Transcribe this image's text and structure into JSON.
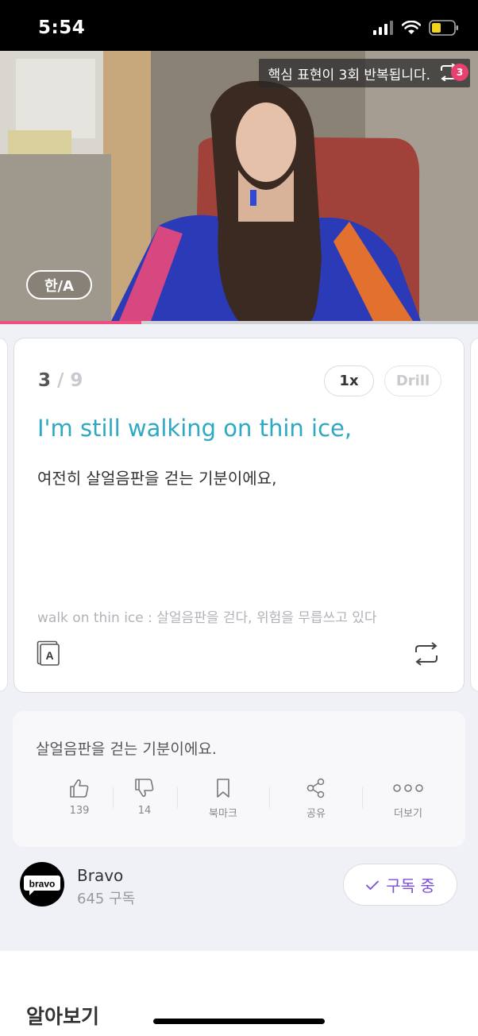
{
  "status_bar": {
    "time": "5:54"
  },
  "video": {
    "repeat_banner": "핵심 표현이 3회 반복됩니다.",
    "repeat_count": "3",
    "lang_toggle": "한/A",
    "progress": 0.295
  },
  "card": {
    "current": "3",
    "total": " / 9",
    "speed_label": "1x",
    "drill_label": "Drill",
    "sentence_en": "I'm still walking on thin ice,",
    "sentence_ko": "여전히 살얼음판을 걷는 기분이에요,",
    "expression_note": "walk on thin ice : 살얼음판을 걷다, 위험을 무릅쓰고 있다",
    "dict_icon_letter": "A"
  },
  "comment": {
    "text": "살얼음판을 걷는 기분이에요.",
    "actions": [
      {
        "icon": "thumbs-up-icon",
        "label": "139"
      },
      {
        "icon": "thumbs-down-icon",
        "label": "14"
      },
      {
        "icon": "bookmark-icon",
        "label": "북마크"
      },
      {
        "icon": "share-icon",
        "label": "공유"
      },
      {
        "icon": "more-icon",
        "label": "더보기"
      }
    ]
  },
  "channel": {
    "logo_text": "bravo",
    "name": "Bravo",
    "subscribers": "645 구독",
    "subscribe_label": "구독 중",
    "accent_color": "#7b4fd6"
  },
  "section": {
    "title": "알아보기"
  },
  "colors": {
    "progress": "#ee4f7e",
    "sentence": "#2ea9c4",
    "badge": "#e8416f"
  }
}
